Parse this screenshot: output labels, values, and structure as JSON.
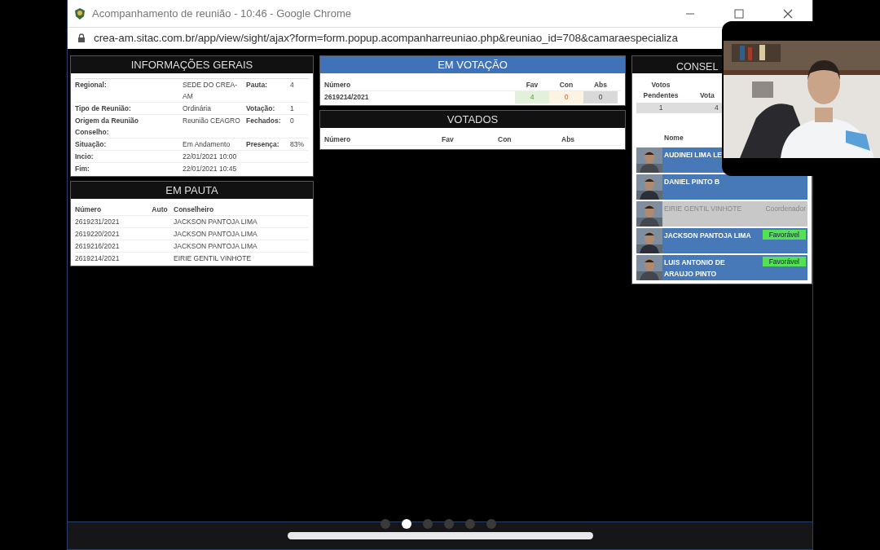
{
  "window": {
    "title": "Acompanhamento de reunião - 10:46 - Google Chrome",
    "url": "crea-am.sitac.com.br/app/view/sight/ajax?form=form.popup.acompanharreuniao.php&reuniao_id=708&camaraespecializa"
  },
  "info": {
    "title": "INFORMAÇÕES GERAIS",
    "rows": [
      {
        "label": "Regional:",
        "value": "SEDE DO CREA-AM",
        "label2": "Pauta:",
        "value2": "4"
      },
      {
        "label": "Tipo de Reunião:",
        "value": "Ordinária",
        "label2": "Votação:",
        "value2": "1"
      },
      {
        "label": "Origem da Reunião Conselho:",
        "value": "Reunião CEAGRO",
        "label2": "Fechados:",
        "value2": "0"
      },
      {
        "label": "Situação:",
        "value": "Em Andamento",
        "label2": "Presença:",
        "value2": "83%"
      },
      {
        "label": "Incio:",
        "value": "22/01/2021 10:00"
      },
      {
        "label": "Fim:",
        "value": "22/01/2021 10:45"
      }
    ]
  },
  "agenda": {
    "title": "EM PAUTA",
    "columns": [
      "Número",
      "Auto",
      "Conselheiro"
    ],
    "rows": [
      [
        "2619231/2021",
        "",
        "JACKSON PANTOJA LIMA"
      ],
      [
        "2619220/2021",
        "",
        "JACKSON PANTOJA LIMA"
      ],
      [
        "2619216/2021",
        "",
        "JACKSON PANTOJA LIMA"
      ],
      [
        "2619214/2021",
        "",
        "EIRIE GENTIL VINHOTE"
      ]
    ]
  },
  "voting": {
    "title": "EM VOTAÇÃO",
    "columns": [
      "Número",
      "Fav",
      "Con",
      "Abs"
    ],
    "rows": [
      [
        "2619214/2021",
        "4",
        "0",
        "0"
      ]
    ]
  },
  "voted": {
    "title": "VOTADOS",
    "columns": [
      "Número",
      "Fav",
      "Con",
      "Abs"
    ]
  },
  "council": {
    "title": "CONSEL",
    "pending_label": "Votos Pendentes",
    "votes_label": "Vota",
    "pending": "1",
    "votes": "4",
    "name_header": "Nome",
    "members": [
      {
        "name": "AUDINEI LIMA LE",
        "kind": "member"
      },
      {
        "name": "DANIEL PINTO B",
        "kind": "member"
      },
      {
        "name": "EIRIE GENTIL VINHOTE",
        "kind": "coordinator",
        "role": "Coordenador"
      },
      {
        "name": "JACKSON PANTOJA LIMA",
        "kind": "member",
        "vote": "Favorável"
      },
      {
        "name": "LUIS ANTONIO DE ARAUJO PINTO",
        "kind": "member",
        "vote": "Favorável"
      }
    ]
  },
  "pager": {
    "pages": [
      {
        "selected": false
      },
      {
        "selected": true
      },
      {
        "selected": false
      },
      {
        "selected": false
      },
      {
        "selected": false
      },
      {
        "selected": false
      }
    ]
  }
}
